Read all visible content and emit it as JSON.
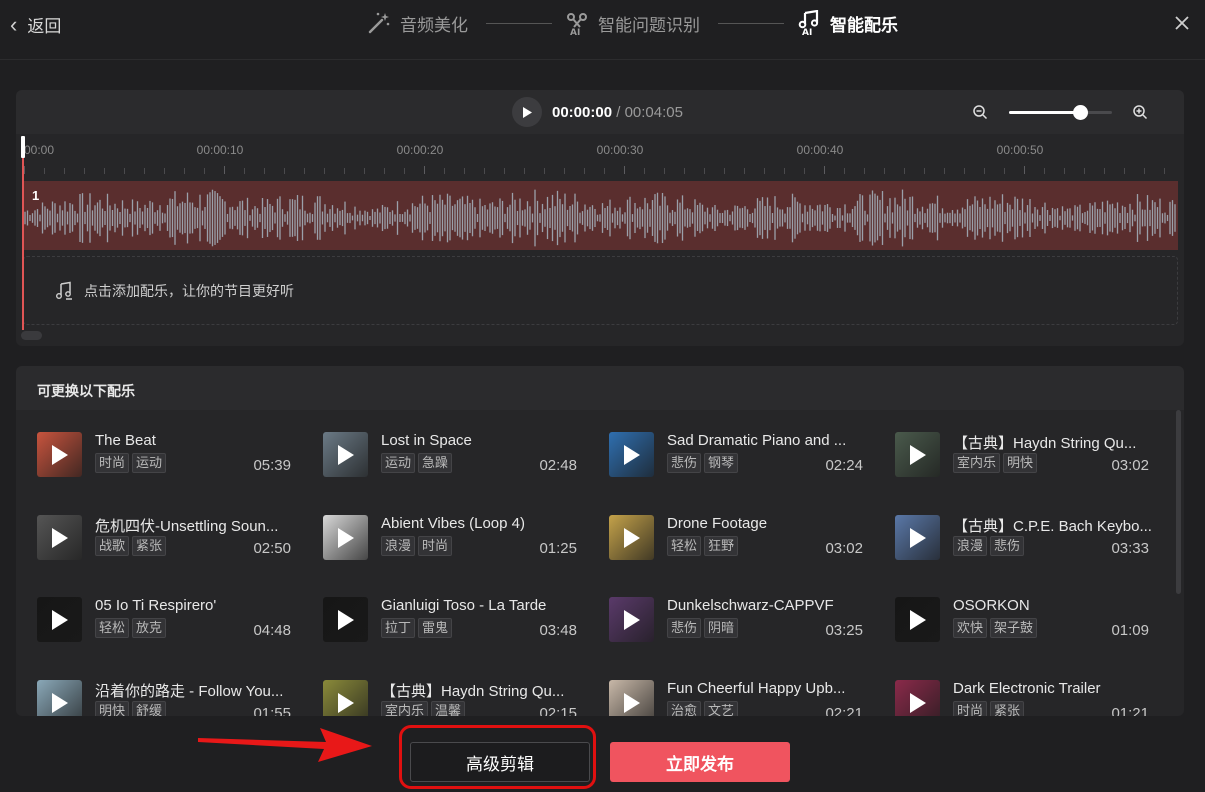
{
  "header": {
    "back_label": "返回",
    "steps": [
      {
        "label": "音频美化",
        "icon": "magic-wand-icon",
        "active": false
      },
      {
        "label": "智能问题识别",
        "icon": "ai-scissors-icon",
        "active": false
      },
      {
        "label": "智能配乐",
        "icon": "ai-music-icon",
        "active": true
      }
    ],
    "close_icon": "close-icon"
  },
  "player": {
    "current_time": "00:00:00",
    "separator": "/",
    "total_time": "00:04:05",
    "zoom_level": 0.69
  },
  "timeline": {
    "ruler_labels": [
      "00:00",
      "00:00:10",
      "00:00:20",
      "00:00:30",
      "00:00:40",
      "00:00:50"
    ],
    "track_number": "1",
    "track_color": "#5a2e2e",
    "add_music_label": "点击添加配乐，让你的节目更好听"
  },
  "music_panel": {
    "title": "可更换以下配乐",
    "items": [
      {
        "title": "The Beat",
        "tags": [
          "时尚",
          "运动"
        ],
        "duration": "05:39",
        "thumb_color": "#c8543e"
      },
      {
        "title": "Lost in Space",
        "tags": [
          "运动",
          "急躁"
        ],
        "duration": "02:48",
        "thumb_color": "#6b7a86"
      },
      {
        "title": "Sad Dramatic Piano and ...",
        "tags": [
          "悲伤",
          "钢琴"
        ],
        "duration": "02:24",
        "thumb_color": "#2f6fb0"
      },
      {
        "title": "【古典】Haydn String Qu...",
        "tags": [
          "室内乐",
          "明快"
        ],
        "duration": "03:02",
        "thumb_color": "#4a5a4c"
      },
      {
        "title": "危机四伏-Unsettling Soun...",
        "tags": [
          "战歌",
          "紧张"
        ],
        "duration": "02:50",
        "thumb_color": "#555555"
      },
      {
        "title": "Abient Vibes (Loop 4)",
        "tags": [
          "浪漫",
          "时尚"
        ],
        "duration": "01:25",
        "thumb_color": "#d8d8d8"
      },
      {
        "title": "Drone Footage",
        "tags": [
          "轻松",
          "狂野"
        ],
        "duration": "03:02",
        "thumb_color": "#c4a24a"
      },
      {
        "title": "【古典】C.P.E. Bach Keybo...",
        "tags": [
          "浪漫",
          "悲伤"
        ],
        "duration": "03:33",
        "thumb_color": "#5a78a8"
      },
      {
        "title": "05 Io Ti Respirero'",
        "tags": [
          "轻松",
          "放克"
        ],
        "duration": "04:48",
        "thumb_color": "#161616"
      },
      {
        "title": "Gianluigi Toso - La Tarde",
        "tags": [
          "拉丁",
          "雷鬼"
        ],
        "duration": "03:48",
        "thumb_color": "#161616"
      },
      {
        "title": "Dunkelschwarz-CAPPVF",
        "tags": [
          "悲伤",
          "阴暗"
        ],
        "duration": "03:25",
        "thumb_color": "#5a3a6a"
      },
      {
        "title": "OSORKON",
        "tags": [
          "欢快",
          "架子鼓"
        ],
        "duration": "01:09",
        "thumb_color": "#161616"
      },
      {
        "title": "沿着你的路走 - Follow You...",
        "tags": [
          "明快",
          "舒缓"
        ],
        "duration": "01:55",
        "thumb_color": "#8aa8b8"
      },
      {
        "title": "【古典】Haydn String Qu...",
        "tags": [
          "室内乐",
          "温馨"
        ],
        "duration": "02:15",
        "thumb_color": "#8a8a3a"
      },
      {
        "title": "Fun Cheerful Happy Upb...",
        "tags": [
          "治愈",
          "文艺"
        ],
        "duration": "02:21",
        "thumb_color": "#c8b8a8"
      },
      {
        "title": "Dark Electronic Trailer",
        "tags": [
          "时尚",
          "紧张"
        ],
        "duration": "01:21",
        "thumb_color": "#8a2a4a"
      }
    ]
  },
  "footer": {
    "advanced_edit_label": "高级剪辑",
    "publish_label": "立即发布",
    "publish_color": "#f0545f"
  }
}
